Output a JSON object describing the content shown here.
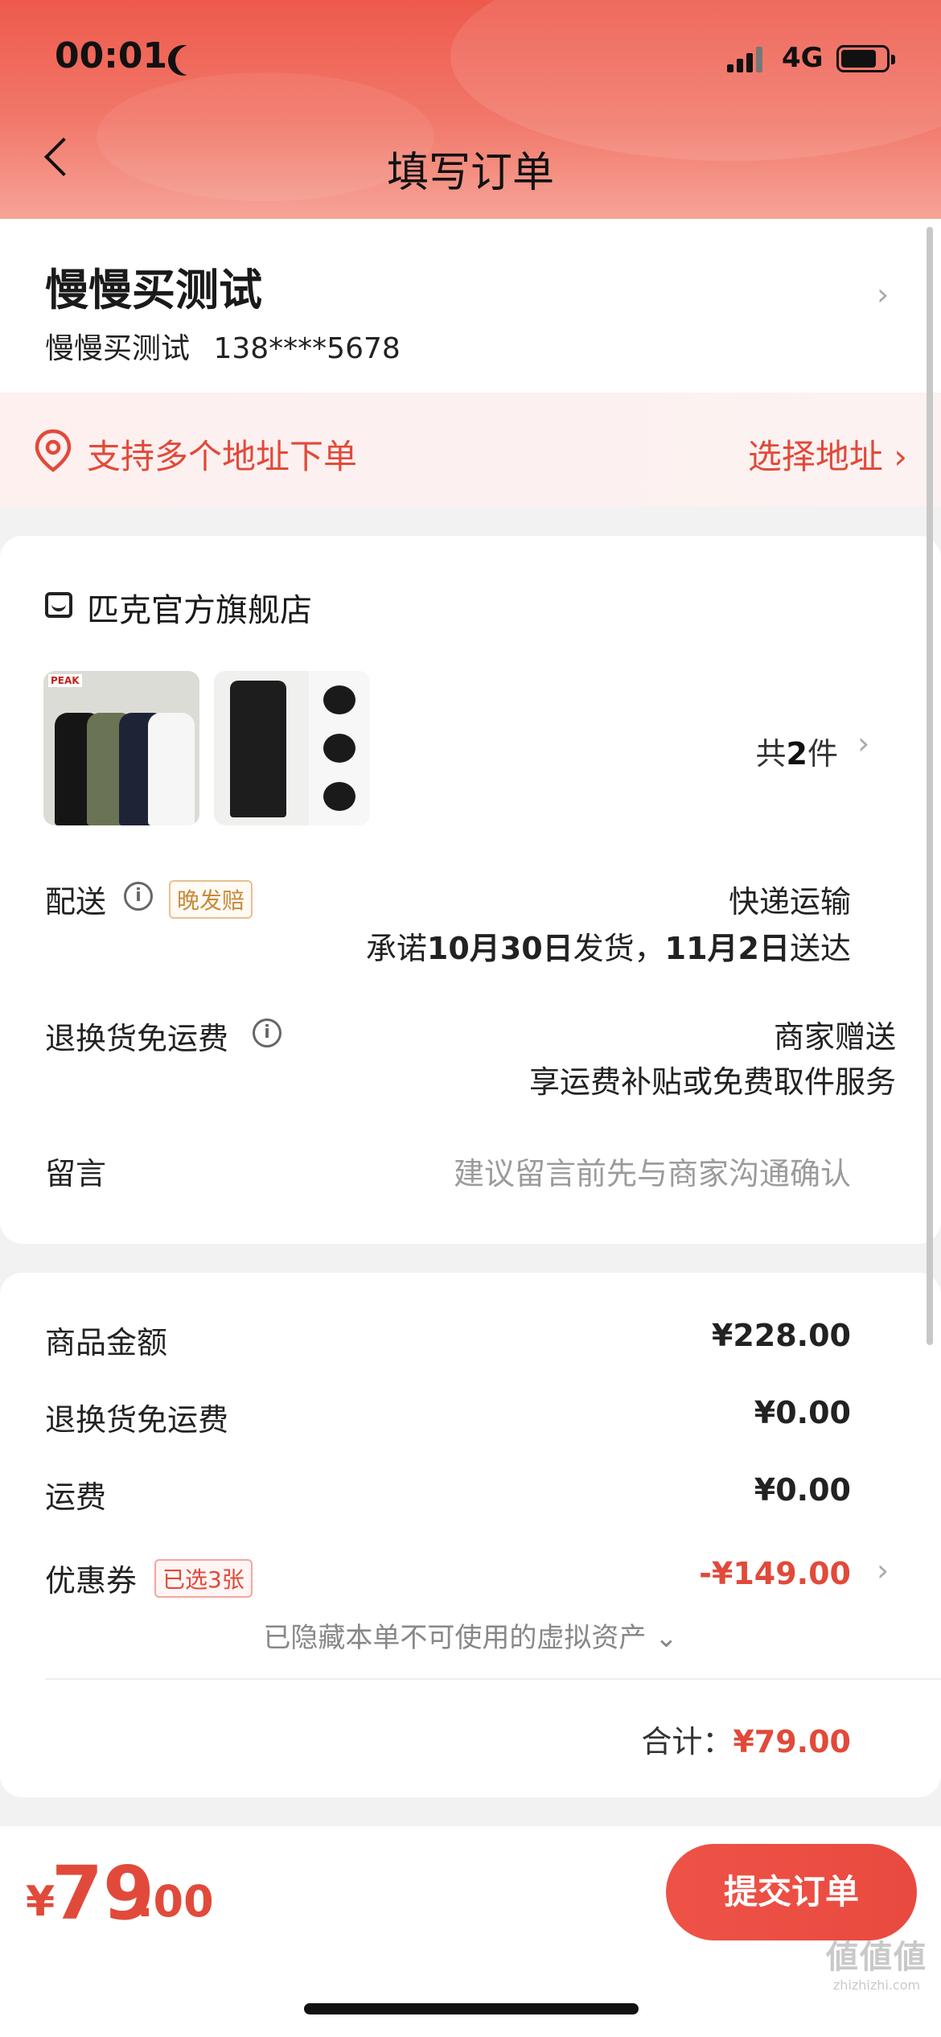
{
  "status_bar": {
    "time": "00:01",
    "network": "4G"
  },
  "nav": {
    "title": "填写订单"
  },
  "address": {
    "name": "慢慢买测试",
    "detail": "慢慢买测试",
    "phone": "138****5678",
    "multi_address_text": "支持多个地址下单",
    "choose_address": "选择地址 ›"
  },
  "store": {
    "name": "匹克官方旗舰店",
    "thumb_logo": "PEAK",
    "item_count_prefix": "共",
    "item_count": "2",
    "item_count_suffix": "件"
  },
  "delivery": {
    "label": "配送",
    "badge": "晚发赔",
    "method": "快递运输",
    "promise_prefix": "承诺",
    "ship_date": "10月30日",
    "ship_text": "发货，",
    "arrive_date": "11月2日",
    "arrive_text": "送达"
  },
  "return_shipping": {
    "label": "退换货免运费",
    "value": "商家赠送",
    "sub": "享运费补贴或免费取件服务"
  },
  "note": {
    "label": "留言",
    "placeholder": "建议留言前先与商家沟通确认"
  },
  "price": {
    "goods_label": "商品金额",
    "goods_value": "¥228.00",
    "return_label": "退换货免运费",
    "return_value": "¥0.00",
    "shipping_label": "运费",
    "shipping_value": "¥0.00",
    "coupon_label": "优惠券",
    "coupon_badge": "已选3张",
    "coupon_value": "-¥149.00",
    "hidden_assets": "已隐藏本单不可使用的虚拟资产 ⌄",
    "total_label": "合计：",
    "total_value": "¥79.00"
  },
  "pay_bar": {
    "currency": "¥",
    "integer": "79",
    "decimal": ".00",
    "submit": "提交订单"
  },
  "watermark": {
    "logo": "値値値",
    "url": "zhizhizhi.com"
  },
  "colors": {
    "accent": "#e14a3a",
    "header_top": "#ee5a4c",
    "badge_gold": "#c78a3a"
  }
}
